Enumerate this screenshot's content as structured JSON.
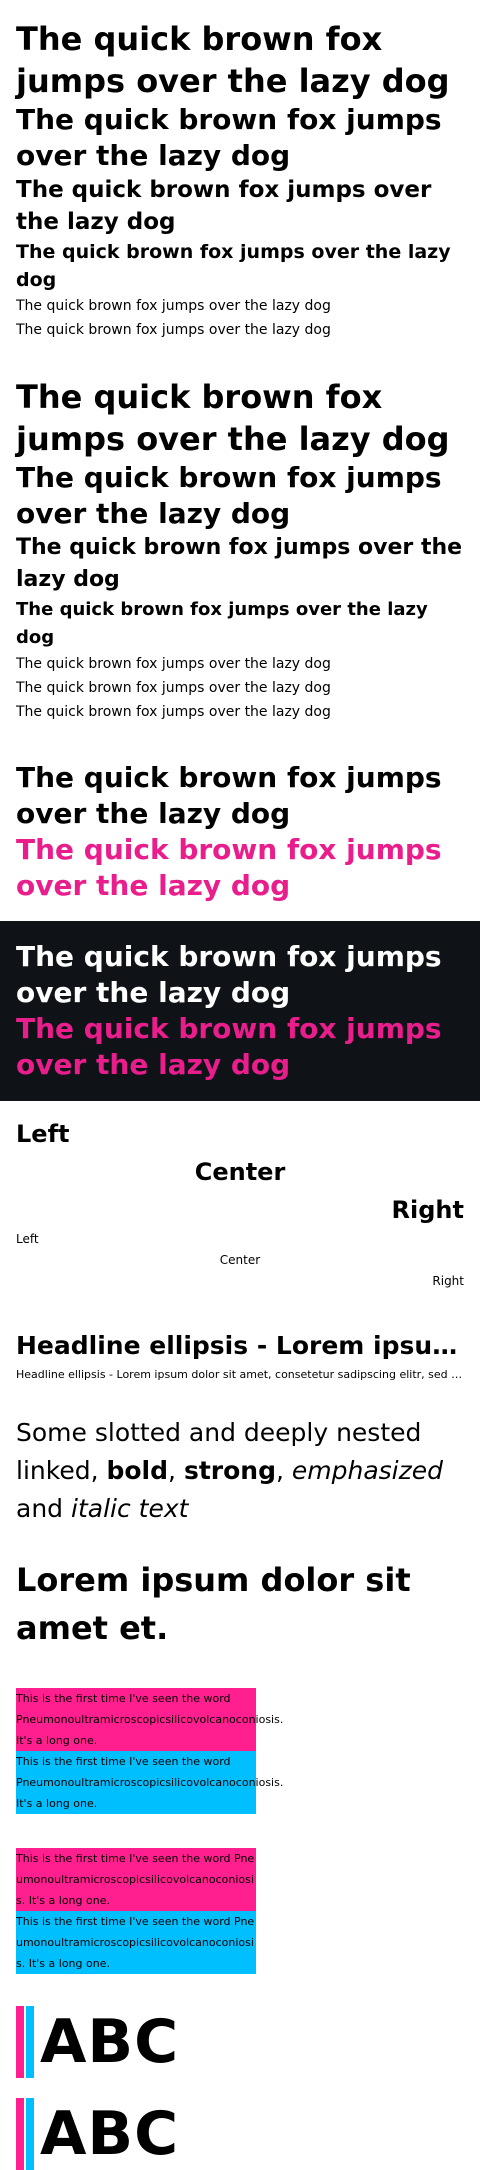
{
  "pangram": "The quick brown fox jumps over the lazy dog",
  "align": {
    "left": "Left",
    "center": "Center",
    "right": "Right"
  },
  "ellipsis": {
    "headline": "Headline ellipsis - Lorem ipsum dolor sit amet, consetetur sadipscing elitr, sed diam",
    "small": "Headline ellipsis - Lorem ipsum dolor sit amet, consetetur sadipscing elitr, sed diam nonumy eirmod tempor invidunt"
  },
  "nested": {
    "lead": "Some slotted and deeply nested",
    "linked": "linked",
    "bold": "bold",
    "strong": "strong",
    "emphasized": "emphasized",
    "and": "and",
    "italic": "italic text",
    "comma1": ",",
    "comma2": ","
  },
  "lorem": "Lorem ipsum dolor sit amet et.",
  "longword": {
    "text": "This is the first time I've seen the word Pneumonoultramicroscopicsilicovolcanoconiosis. It's a long one."
  },
  "abc": "ABC",
  "colors": {
    "accent_pink": "#ff1f8e",
    "accent_blue": "#00bfff",
    "dark_bg": "#0f1318",
    "pink_text": "#e91e8c"
  }
}
